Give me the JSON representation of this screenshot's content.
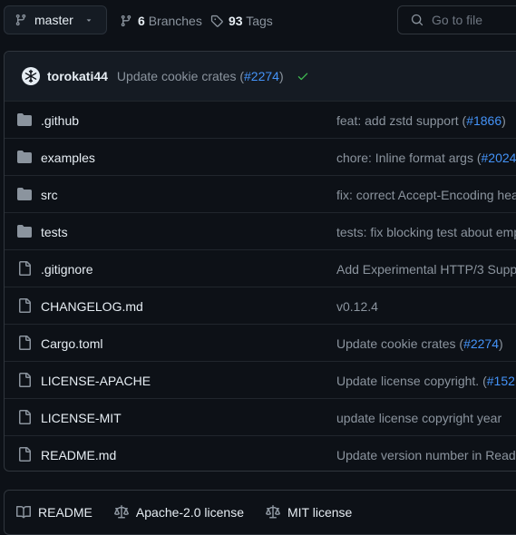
{
  "header": {
    "branch": "master",
    "branches_count": "6",
    "branches_label": "Branches",
    "tags_count": "93",
    "tags_label": "Tags",
    "goto_placeholder": "Go to file"
  },
  "latest_commit": {
    "author": "torokati44",
    "message": "Update cookie crates (",
    "pr": "#2274",
    "message_end": ")",
    "status": "success"
  },
  "files": [
    {
      "type": "folder",
      "name": ".github",
      "msg": "feat: add zstd support (",
      "pr": "#1866",
      "end": ")"
    },
    {
      "type": "folder",
      "name": "examples",
      "msg": "chore: Inline format args (",
      "pr": "#2024",
      "end": ""
    },
    {
      "type": "folder",
      "name": "src",
      "msg": "fix: correct Accept-Encoding hea",
      "pr": "",
      "end": ""
    },
    {
      "type": "folder",
      "name": "tests",
      "msg": "tests: fix blocking test about emp",
      "pr": "",
      "end": ""
    },
    {
      "type": "file",
      "name": ".gitignore",
      "msg": "Add Experimental HTTP/3 Suppo",
      "pr": "",
      "end": ""
    },
    {
      "type": "file",
      "name": "CHANGELOG.md",
      "msg": "v0.12.4",
      "pr": "",
      "end": ""
    },
    {
      "type": "file",
      "name": "Cargo.toml",
      "msg": "Update cookie crates (",
      "pr": "#2274",
      "end": ")"
    },
    {
      "type": "file",
      "name": "LICENSE-APACHE",
      "msg": "Update license copyright. (",
      "pr": "#152",
      "end": ""
    },
    {
      "type": "file",
      "name": "LICENSE-MIT",
      "msg": "update license copyright year",
      "pr": "",
      "end": ""
    },
    {
      "type": "file",
      "name": "README.md",
      "msg": "Update version number in Read",
      "pr": "",
      "end": ""
    }
  ],
  "readme_tabs": [
    {
      "label": "README",
      "icon": "book-icon"
    },
    {
      "label": "Apache-2.0 license",
      "icon": "scale-icon"
    },
    {
      "label": "MIT license",
      "icon": "scale-icon"
    }
  ],
  "colors": {
    "background": "#0d1117",
    "link": "#4493f8",
    "success": "#3fb950",
    "muted": "#8b949e"
  }
}
